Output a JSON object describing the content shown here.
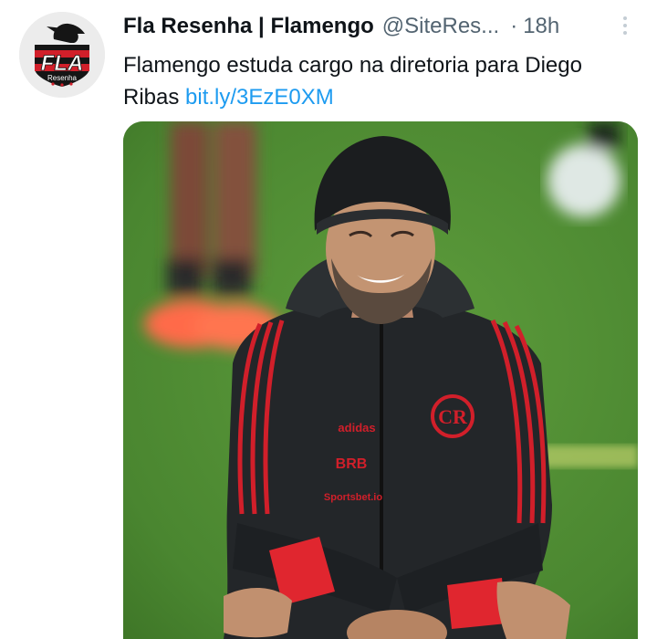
{
  "tweet": {
    "author": {
      "name": "Fla Resenha | Flamengo",
      "handle": "@SiteRes...",
      "avatar_text": "FLA",
      "avatar_subtext": "Resenha"
    },
    "separator": "·",
    "time": "18h",
    "text": "Flamengo estuda cargo na diretoria para Diego Ribas",
    "link": "bit.ly/3EzE0XM",
    "media": {
      "jacket_brand": "adidas",
      "sponsor_1": "BRB",
      "sponsor_2": "Sportsbet.io"
    },
    "more_icon": "more-vertical-icon",
    "colors": {
      "link": "#1d9bf0",
      "secondary_text": "#536471",
      "flamengo_red": "#d11f2a",
      "flamengo_black": "#141414"
    }
  }
}
